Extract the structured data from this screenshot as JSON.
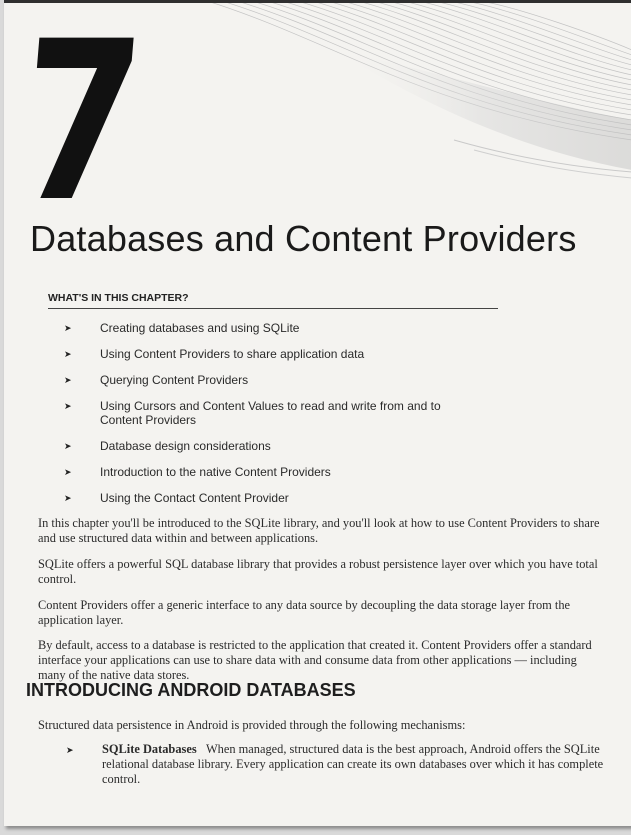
{
  "chapter": {
    "number": "7",
    "title": "Databases and Content Providers"
  },
  "whats_in_chapter": {
    "heading": "WHAT'S IN THIS CHAPTER?",
    "bullet_glyph": "➤",
    "items": [
      "Creating databases and using SQLite",
      "Using Content Providers to share application data",
      "Querying Content Providers",
      "Using Cursors and Content Values to read and write from and to Content Providers",
      "Database design considerations",
      "Introduction to the native Content Providers",
      "Using the Contact Content Provider"
    ]
  },
  "paragraphs": [
    "In this chapter you'll be introduced to the SQLite library, and you'll look at how to use Content Providers to share and use structured data within and between applications.",
    "SQLite offers a powerful SQL database library that provides a robust persistence layer over which you have total control.",
    "Content Providers offer a generic interface to any data source by decoupling the data storage layer from the application layer.",
    "By default, access to a database is restricted to the application that created it. Content Providers offer a standard interface your applications can use to share data with and consume data from other applications — including many of the native data stores."
  ],
  "section": {
    "heading": "INTRODUCING ANDROID DATABASES",
    "intro": "Structured data persistence in Android is provided through the following mechanisms:",
    "items": [
      {
        "term": "SQLite Databases",
        "text": "When managed, structured data is the best approach, Android offers the SQLite relational database library. Every application can create its own databases over which it has complete control."
      }
    ]
  }
}
